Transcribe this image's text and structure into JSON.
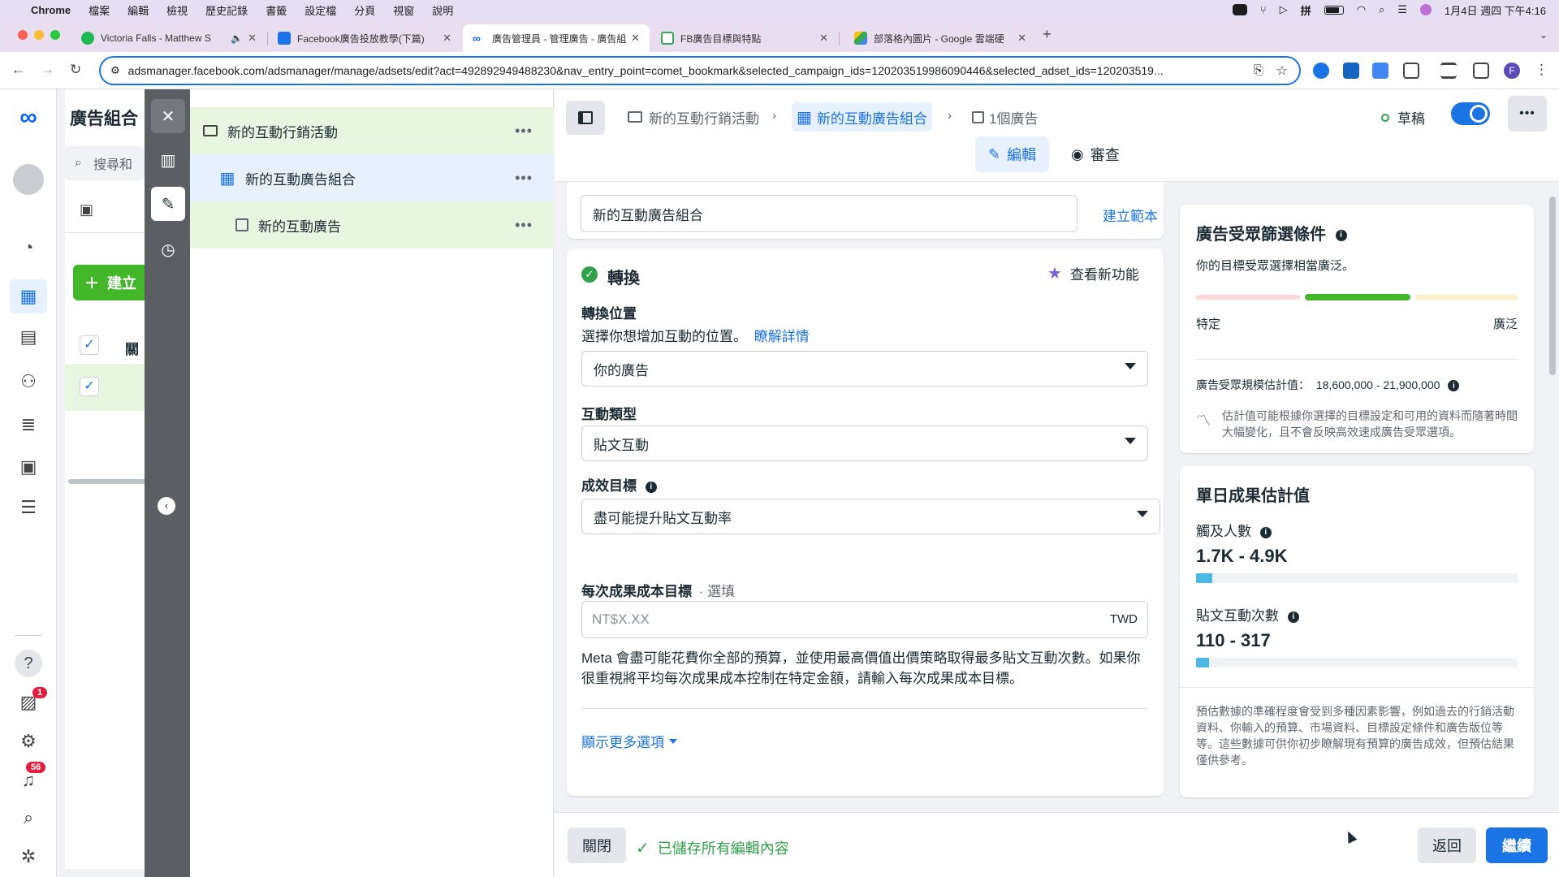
{
  "mac_menu": {
    "app": "Chrome",
    "items": [
      "檔案",
      "編輯",
      "檢視",
      "歷史記錄",
      "書籤",
      "設定檔",
      "分頁",
      "視窗",
      "說明"
    ],
    "clock": "1月4日 週四 下午4:16"
  },
  "tabs": [
    {
      "title": "Victoria Falls - Matthew S",
      "color": "#1db954"
    },
    {
      "title": "Facebook廣告投放教學(下篇)",
      "color": "#1a73e8"
    },
    {
      "title": "廣告管理員 - 管理廣告 - 廣告組",
      "color": "#0866ff"
    },
    {
      "title": "FB廣告目標與特點",
      "color": "#34a853"
    },
    {
      "title": "部落格內圖片 - Google 雲端硬",
      "color": "#fbbc04"
    }
  ],
  "address_bar": {
    "url": "adsmanager.facebook.com/adsmanager/manage/adsets/edit?act=492892949488230&nav_entry_point=comet_bookmark&selected_campaign_ids=120203519986090446&selected_adset_ids=120203519..."
  },
  "left_rail": {
    "badges": {
      "campaigns": "1",
      "notifications": "56"
    }
  },
  "bg_panel": {
    "title": "廣告組合",
    "search_placeholder": "搜尋和",
    "create_label": "建立",
    "col_header": "關"
  },
  "tree": {
    "items": [
      {
        "label": "新的互動行銷活動",
        "icon": "folder-icon"
      },
      {
        "label": "新的互動廣告組合",
        "icon": "grid-icon"
      },
      {
        "label": "新的互動廣告",
        "icon": "ad-icon"
      }
    ]
  },
  "header": {
    "breadcrumbs": [
      {
        "label": "新的互動行銷活動",
        "icon": "folder-icon"
      },
      {
        "label": "新的互動廣告組合",
        "icon": "grid-icon"
      },
      {
        "label": "1個廣告",
        "icon": "ad-icon"
      }
    ],
    "status": "草稿",
    "edit_tab": "編輯",
    "review_tab": "審查"
  },
  "form": {
    "adset_name_value": "新的互動廣告組合",
    "create_template": "建立範本",
    "section_title": "轉換",
    "whats_new": "查看新功能",
    "conversion_location_label": "轉換位置",
    "conversion_location_help": "選擇你想增加互動的位置。",
    "learn_more": "瞭解詳情",
    "conversion_location_value": "你的廣告",
    "engagement_type_label": "互動類型",
    "engagement_type_value": "貼文互動",
    "performance_goal_label": "成效目標",
    "performance_goal_value": "盡可能提升貼文互動率",
    "cost_goal_label": "每次成果成本目標",
    "cost_goal_optional": "· 選填",
    "cost_goal_placeholder": "NT$X.XX",
    "currency": "TWD",
    "cost_goal_desc": "Meta 會盡可能花費你全部的預算，並使用最高價值出價策略取得最多貼文互動次數。如果你很重視將平均每次成果成本控制在特定金額，請輸入每次成果成本目標。",
    "show_more": "顯示更多選項"
  },
  "audience": {
    "title": "廣告受眾篩選條件",
    "subtitle": "你的目標受眾選擇相當廣泛。",
    "specific": "特定",
    "broad": "廣泛",
    "size_label": "廣告受眾規模估計值：",
    "size_value": "18,600,000 - 21,900,000",
    "note": "估計值可能根據你選擇的目標設定和可用的資料而隨著時間大幅變化，且不會反映高效速成廣告受眾選項。"
  },
  "daily_results": {
    "title": "單日成果估計值",
    "reach_label": "觸及人數",
    "reach_value": "1.7K - 4.9K",
    "reach_fill": 0.05,
    "engagement_label": "貼文互動次數",
    "engagement_value": "110 - 317",
    "engagement_fill": 0.04,
    "disclaimer": "預估數據的準確程度會受到多種因素影響，例如過去的行銷活動資料、你輸入的預算、市場資料、目標設定條件和廣告版位等等。這些數據可供你初步瞭解現有預算的廣告成效，但預估結果僅供參考。"
  },
  "footer": {
    "close": "關閉",
    "saved": "已儲存所有編輯內容",
    "back": "返回",
    "continue": "繼續"
  },
  "colors": {
    "accent": "#1b74e4",
    "success": "#31a24c",
    "meter_green": "#42b72a",
    "result_bar": "#4cb8e6"
  }
}
